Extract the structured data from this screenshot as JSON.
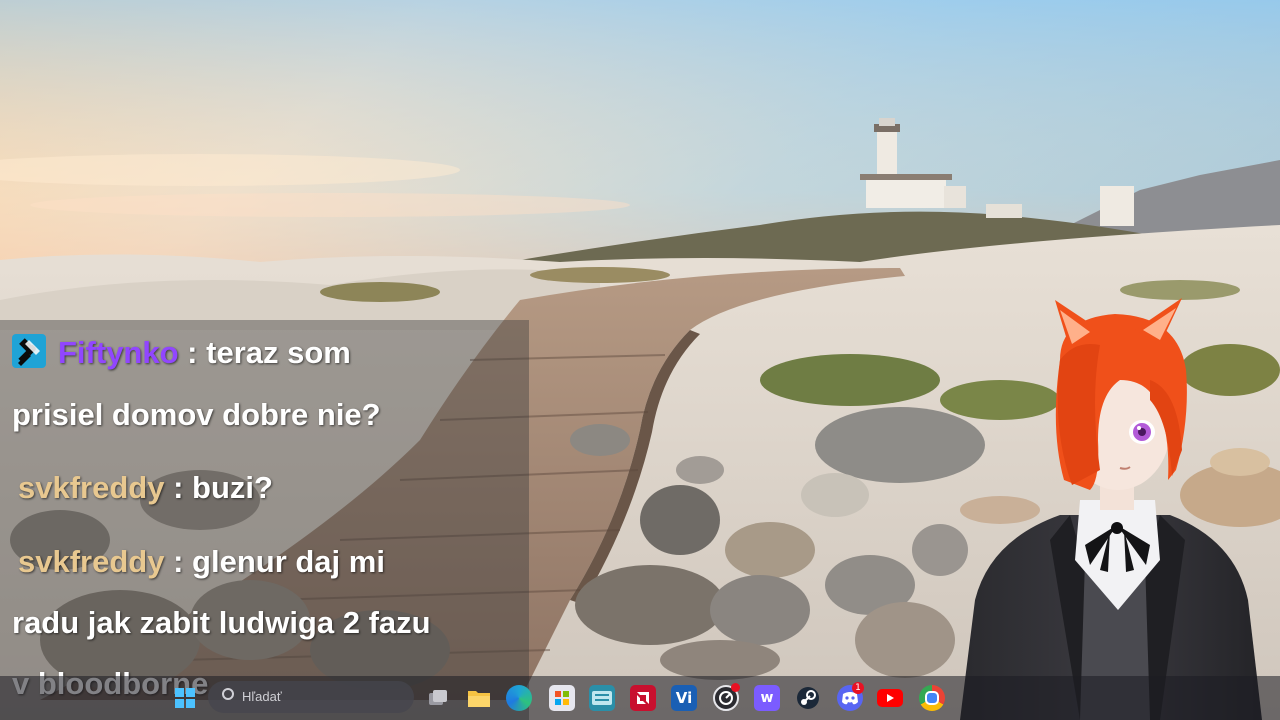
{
  "chat": {
    "messages": [
      {
        "user": "Fiftynko",
        "user_color": "#9146ff",
        "badge": "moderator-badge-icon",
        "separator": " : ",
        "text_line1": "teraz som",
        "text_line2": "prisiel domov dobre nie?"
      },
      {
        "user": "svkfreddy",
        "user_color": "#e8c890",
        "separator": " : ",
        "text_line1": "buzi?"
      },
      {
        "user": "svkfreddy",
        "user_color": "#e8c890",
        "separator": " : ",
        "text_line1": "glenur daj mi",
        "text_line2": "radu jak zabit ludwiga 2 fazu",
        "text_line3": "v bloodborne"
      }
    ]
  },
  "taskbar": {
    "search_placeholder": "Hľadať",
    "icons": [
      "windows-start-icon",
      "search-icon",
      "task-view-icon",
      "file-explorer-icon",
      "edge-icon",
      "store-icon",
      "keyboard-app-icon",
      "amd-icon",
      "vegas-icon",
      "obs-recording-icon",
      "stream-app-icon",
      "steam-icon",
      "discord-icon",
      "youtube-icon",
      "chrome-icon"
    ],
    "discord_notifications": "1"
  },
  "colors": {
    "sky_top": "#8cc4ea",
    "sunset": "#f6c49a",
    "avatar_hair": "#f0501a",
    "moderator_badge": "#1fa3d6"
  }
}
